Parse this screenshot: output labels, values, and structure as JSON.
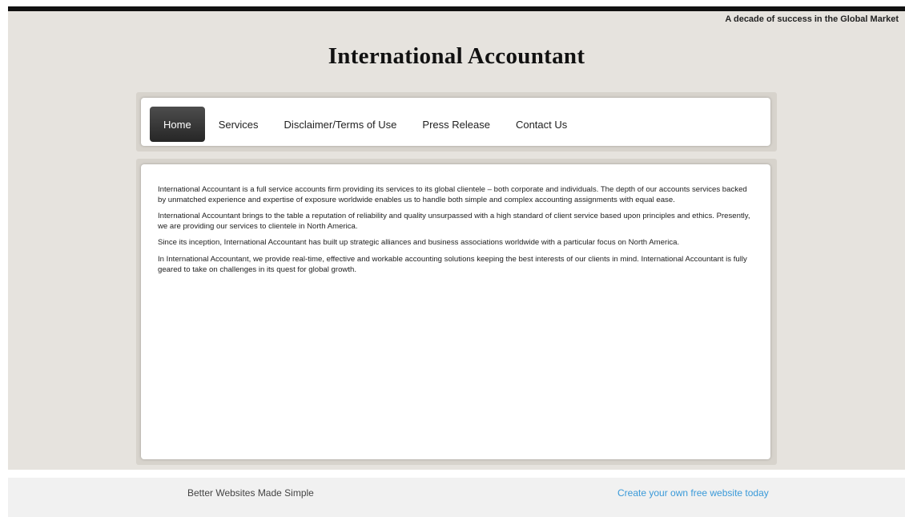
{
  "header": {
    "tagline": "A decade of success in the Global Market",
    "site_title": "International Accountant"
  },
  "nav": {
    "items": [
      {
        "label": "Home",
        "active": true
      },
      {
        "label": "Services"
      },
      {
        "label": "Disclaimer/Terms of Use"
      },
      {
        "label": "Press Release"
      },
      {
        "label": "Contact Us"
      }
    ]
  },
  "content": {
    "paragraphs": [
      "International Accountant is a full service accounts firm providing its services to its global clientele – both corporate and individuals. The depth of our accounts services backed by unmatched experience and expertise of exposure worldwide enables us to handle both simple and complex accounting assignments with equal ease.",
      "International Accountant brings to the table a reputation of reliability and quality unsurpassed with a high standard of client service based upon principles and ethics. Presently, we are providing our services to clientele in North America.",
      "Since its inception, International Accountant has built up strategic alliances and business associations worldwide with a particular focus on North America.",
      "In International Accountant, we provide real-time, effective and workable accounting solutions keeping the best interests of our clients in mind. International Accountant is fully geared to take on challenges in its quest for global growth."
    ]
  },
  "footer": {
    "left_text": "Better Websites Made Simple",
    "right_link": "Create your own free website today",
    "link_color": "#3a9ad9"
  }
}
